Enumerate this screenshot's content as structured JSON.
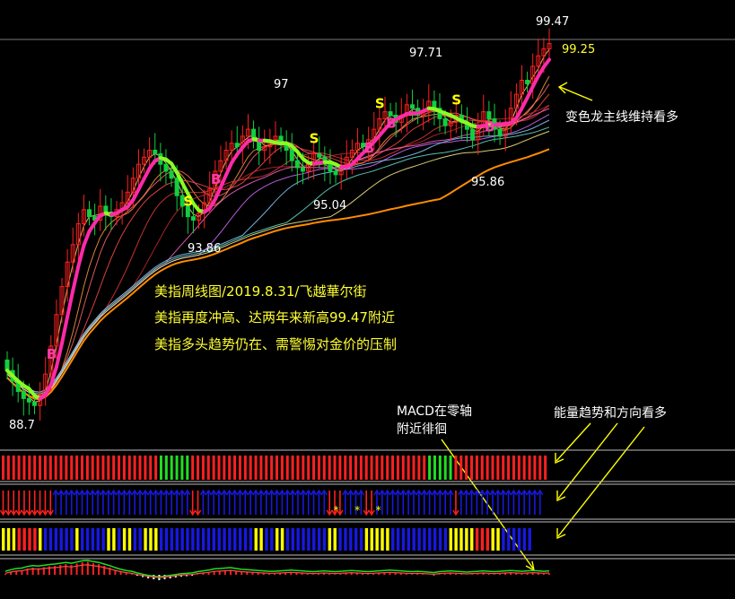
{
  "chart_data": {
    "type": "candlestick",
    "price_ticks": [
      {
        "label": "99.47",
        "value": 99.47
      },
      {
        "label": "99.25",
        "value": 99.25
      },
      {
        "label": "97.71",
        "value": 97.71
      },
      {
        "label": "97",
        "value": 97.0
      },
      {
        "label": "95.86",
        "value": 95.86
      },
      {
        "label": "95.04",
        "value": 95.04
      },
      {
        "label": "93.86",
        "value": 93.86
      },
      {
        "label": "88.7",
        "value": 88.7
      }
    ],
    "closes": [
      89.9,
      89.6,
      89.3,
      89.1,
      89.0,
      88.9,
      89.2,
      89.8,
      90.6,
      91.5,
      92.3,
      93.0,
      93.5,
      94.1,
      94.5,
      94.3,
      94.2,
      94.6,
      94.4,
      94.3,
      94.5,
      94.7,
      95.0,
      95.4,
      95.8,
      96.0,
      96.2,
      96.1,
      95.8,
      95.6,
      95.4,
      94.9,
      94.6,
      94.3,
      94.2,
      94.4,
      94.7,
      95.1,
      95.6,
      95.9,
      96.2,
      96.4,
      96.3,
      96.6,
      96.8,
      96.5,
      96.2,
      96.3,
      96.5,
      96.6,
      96.4,
      96.2,
      95.9,
      95.7,
      95.6,
      95.8,
      96.1,
      96.0,
      95.8,
      95.6,
      95.5,
      95.7,
      96.0,
      96.2,
      96.4,
      96.3,
      96.5,
      96.8,
      97.1,
      97.3,
      97.2,
      97.0,
      97.2,
      97.5,
      97.4,
      97.2,
      97.3,
      97.6,
      97.4,
      97.1,
      96.9,
      97.0,
      97.2,
      97.0,
      96.8,
      96.5,
      96.9,
      97.3,
      97.1,
      96.8,
      96.6,
      97.0,
      97.4,
      97.8,
      98.2,
      98.1,
      98.6,
      98.9,
      99.1,
      99.25
    ],
    "signals": [
      {
        "text": "B",
        "index": 8,
        "color": "#ff3aa8"
      },
      {
        "text": "S",
        "index": 33,
        "color": "#ffff00"
      },
      {
        "text": "B",
        "index": 38,
        "color": "#ff3aa8"
      },
      {
        "text": "S",
        "index": 56,
        "color": "#ffff00"
      },
      {
        "text": "B",
        "index": 66,
        "color": "#ff3aa8"
      },
      {
        "text": "S",
        "index": 68,
        "color": "#ffff00"
      },
      {
        "text": "B",
        "index": 70,
        "color": "#ff3aa8"
      },
      {
        "text": "S",
        "index": 82,
        "color": "#ffff00"
      },
      {
        "text": "B",
        "index": 88,
        "color": "#ff3aa8"
      }
    ],
    "energy_colors": "RRRRRRRRRRRRRRRRRRRRRRRRRRRRRRGGGGGGRRRRRRRRRRRRRRRRRRRRRRRRRRRRRRRRRRRRRRRRRRRRRGGGGGRRRRRRRRRRRRRRRRRR",
    "arrow_dirs": "dddddddddduuuuuuuuuuuuuuuuuuuuuuuuuudduuuuuuuuuuuuuuuuuuuuuuuuddduuuudduuuuuuuuuuuuuuuduuuuuuuuuuuuuuuu",
    "star_indices": [
      62,
      66,
      70
    ],
    "trend_colors": "YYYRRRRYBBBBBBYBBBBBYYBYYBBYYYBBBBBBBBBBBBBBBBBBYYBBYYBBBBBBBBYYBBBBBYYYYYBBBBBBBBBBBYYYYYRRRYYBBBBBB",
    "macd_hist": [
      0.2,
      0.6,
      0.9,
      1.0,
      1.4,
      1.6,
      1.5,
      1.7,
      1.9,
      2.0,
      2.2,
      2.4,
      2.2,
      2.5,
      2.8,
      2.9,
      2.6,
      2.4,
      2.0,
      1.6,
      1.1,
      0.7,
      0.4,
      0.2,
      -0.2,
      -0.5,
      -0.8,
      -1.0,
      -1.2,
      -1.0,
      -0.8,
      -0.6,
      -0.4,
      -0.3,
      -0.2,
      0.1,
      0.3,
      0.5,
      0.8,
      0.9,
      1.0,
      1.1,
      0.9,
      0.7,
      0.6,
      0.5,
      0.4,
      0.3,
      0.2,
      0.2,
      0.3,
      0.4,
      0.5,
      0.4,
      0.3,
      0.2,
      0.1,
      0.2,
      0.3,
      0.2,
      0.1,
      0.2,
      0.3,
      0.4,
      0.3,
      0.2,
      0.1,
      0.2,
      0.3,
      0.4,
      0.5,
      0.4,
      0.3,
      0.2,
      0.1,
      0.2,
      0.1,
      0.0,
      -0.1,
      0.1,
      0.2,
      0.3,
      0.2,
      0.1,
      0.0,
      0.1,
      0.2,
      0.3,
      0.2,
      0.1,
      0.2,
      0.3,
      0.4,
      0.3,
      0.2,
      0.3,
      0.4,
      0.3,
      0.2,
      0.3
    ]
  },
  "annotations": {
    "title_line": "美指周线图/2019.8.31/飞越華尔街",
    "line2": "美指再度冲高、达两年来新高99.47附近",
    "line3": "美指多头趋势仍在、需警惕对金价的压制",
    "dragon_note": "变色龙主线维持看多",
    "macd_note_1": "MACD在零轴",
    "macd_note_2": "附近徘徊",
    "energy_note": "能量趋势和方向看多"
  },
  "colors": {
    "up": "#ff2020",
    "down": "#10d040",
    "blue": "#1818e0",
    "yellow": "#ffff00",
    "magenta": "#ff2aa8",
    "green": "#22dd22",
    "orange": "#ff8c00"
  }
}
